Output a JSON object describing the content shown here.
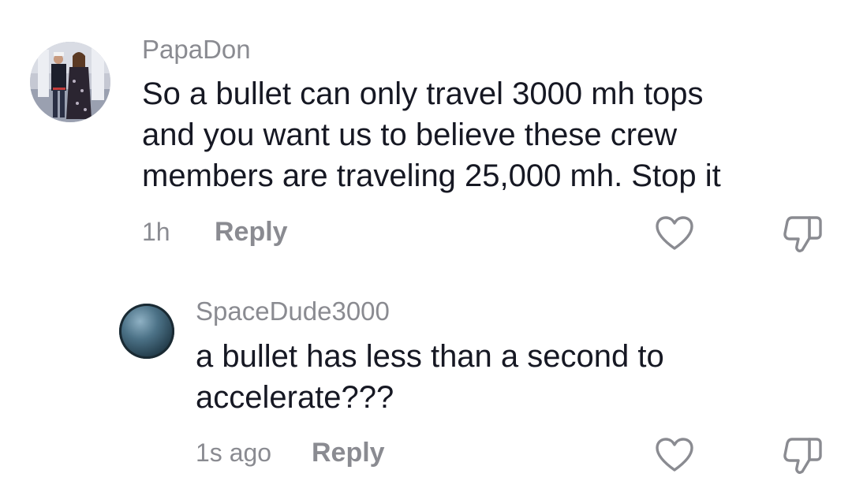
{
  "comments": [
    {
      "username": "PapaDon",
      "text_lines": [
        "So a bullet can only travel 3000 mh tops",
        "and you want us to believe these crew",
        "members are traveling 25,000 mh. Stop it"
      ],
      "time": "1h",
      "reply_label": "Reply",
      "like_icon": "heart-outline-icon",
      "dislike_icon": "thumbs-down-icon"
    },
    {
      "username": "SpaceDude3000",
      "text_lines": [
        "a bullet has less than a second to",
        "accelerate???"
      ],
      "time": "1s ago",
      "reply_label": "Reply",
      "like_icon": "heart-outline-icon",
      "dislike_icon": "thumbs-down-icon"
    }
  ],
  "colors": {
    "text": "#161823",
    "muted": "#8a8b91",
    "background": "#ffffff"
  }
}
